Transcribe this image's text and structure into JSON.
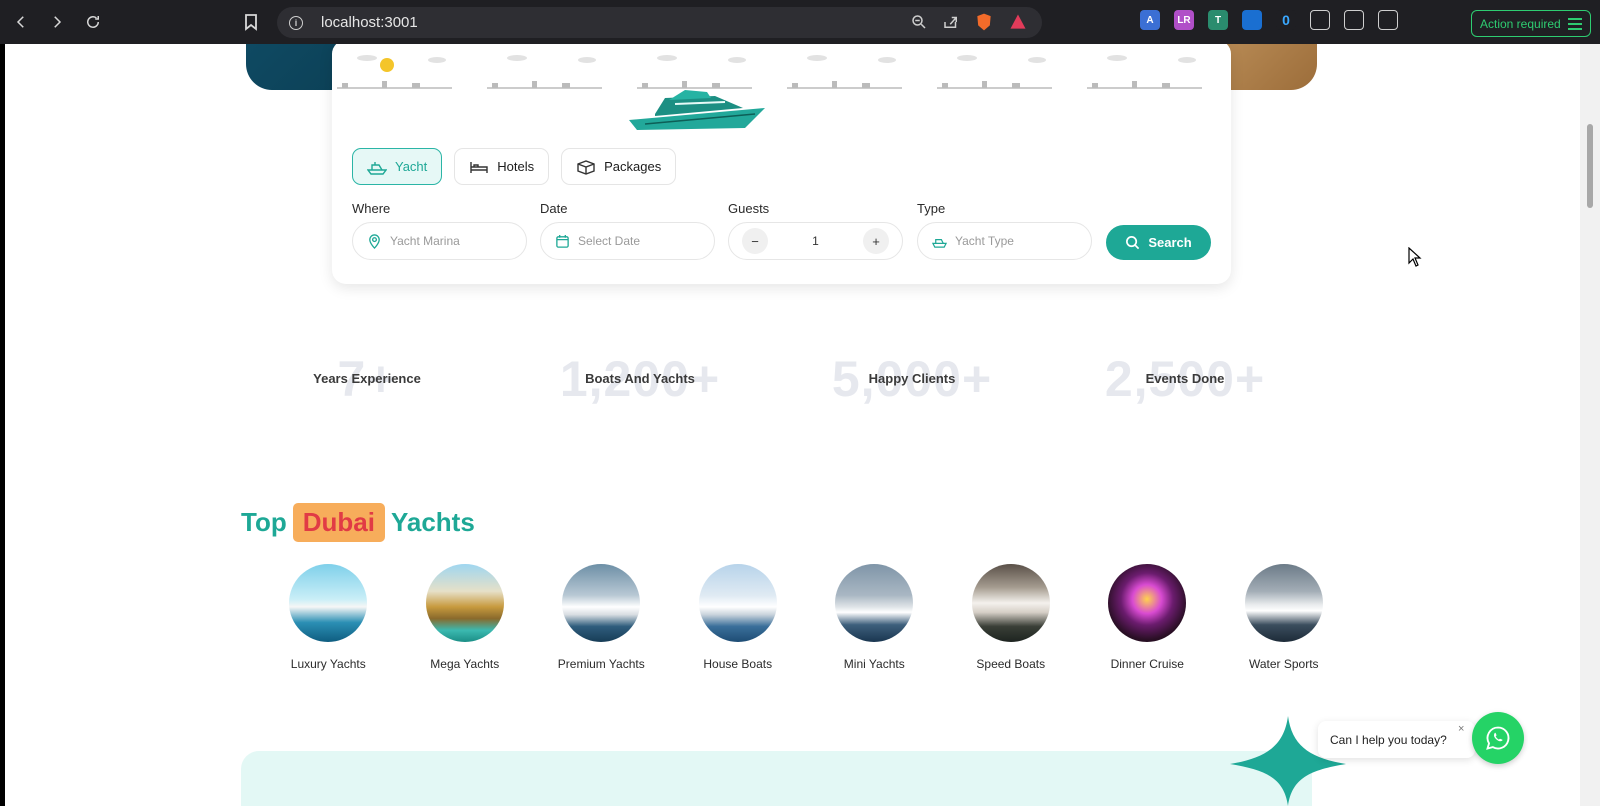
{
  "browser": {
    "url": "localhost:3001",
    "action_label": "Action required",
    "extensions": [
      {
        "icon": "translate-icon",
        "text": "A",
        "color": "#3b6fd4"
      },
      {
        "icon": "lr-icon",
        "text": "LR",
        "color": "#b04fc8"
      },
      {
        "icon": "reader-icon",
        "text": "T",
        "color": "#2a8c6e"
      },
      {
        "icon": "blue-square-icon",
        "text": "",
        "color": "#1a6fd1"
      },
      {
        "icon": "zero-icon",
        "text": "0",
        "color": "#1f1f23"
      },
      {
        "icon": "camera-icon",
        "text": "",
        "color": "#555"
      },
      {
        "icon": "puzzle-icon",
        "text": "",
        "color": "#1f1f23"
      },
      {
        "icon": "key-icon",
        "text": "",
        "color": "#1f1f23"
      }
    ]
  },
  "search": {
    "tabs": [
      {
        "label": "Yacht",
        "active": true
      },
      {
        "label": "Hotels",
        "active": false
      },
      {
        "label": "Packages",
        "active": false
      }
    ],
    "where_label": "Where",
    "where_placeholder": "Yacht Marina",
    "date_label": "Date",
    "date_placeholder": "Select Date",
    "guests_label": "Guests",
    "guests_value": "1",
    "minus": "−",
    "plus": "+",
    "type_label": "Type",
    "type_placeholder": "Yacht Type",
    "search_label": "Search"
  },
  "stats": [
    {
      "number": "7+",
      "label": "Years Experience"
    },
    {
      "number": "1,200+",
      "label": "Boats And Yachts"
    },
    {
      "number": "5,000+",
      "label": "Happy Clients"
    },
    {
      "number": "2,500+",
      "label": "Events Done"
    }
  ],
  "section": {
    "title_pre": "Top",
    "title_highlight": "Dubai",
    "title_post": "Yachts"
  },
  "categories": [
    {
      "label": "Luxury Yachts"
    },
    {
      "label": "Mega Yachts"
    },
    {
      "label": "Premium Yachts"
    },
    {
      "label": "House Boats"
    },
    {
      "label": "Mini Yachts"
    },
    {
      "label": "Speed Boats"
    },
    {
      "label": "Dinner Cruise"
    },
    {
      "label": "Water Sports"
    }
  ],
  "chat": {
    "text": "Can I help you today?",
    "close": "×"
  },
  "colors": {
    "accent": "#1ea896",
    "highlight_bg": "#f7ad5b",
    "highlight_text": "#e13b45",
    "whatsapp": "#25d366"
  }
}
